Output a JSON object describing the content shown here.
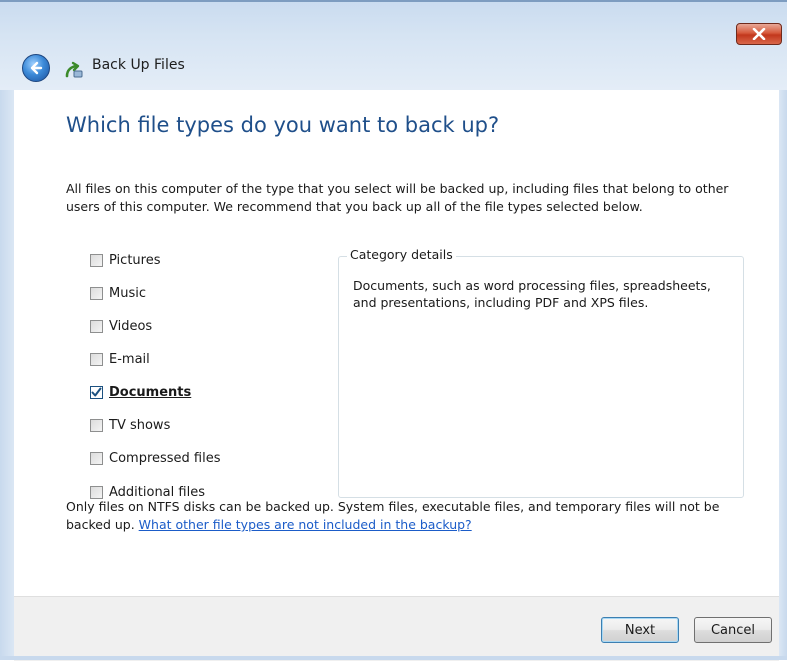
{
  "window": {
    "title": "Back Up Files"
  },
  "page": {
    "heading": "Which file types do you want to back up?",
    "intro": "All files on this computer of the type that you select will be backed up, including files that belong to other users of this computer. We recommend that you back up all of the file types selected below."
  },
  "file_types": [
    {
      "label": "Pictures",
      "checked": false
    },
    {
      "label": "Music",
      "checked": false
    },
    {
      "label": "Videos",
      "checked": false
    },
    {
      "label": "E-mail",
      "checked": false
    },
    {
      "label": "Documents",
      "checked": true
    },
    {
      "label": "TV shows",
      "checked": false
    },
    {
      "label": "Compressed files",
      "checked": false
    },
    {
      "label": "Additional files",
      "checked": false
    }
  ],
  "category_details": {
    "legend": "Category details",
    "text": "Documents, such as word processing files, spreadsheets, and presentations, including PDF and XPS files."
  },
  "note": {
    "text": "Only files on NTFS disks can be backed up. System files, executable files, and temporary files will not be backed up. ",
    "link": "What other file types are not included in the backup?"
  },
  "buttons": {
    "next": "Next",
    "cancel": "Cancel"
  },
  "colors": {
    "heading": "#1f4f8a",
    "link": "#1b5cc8",
    "close_button": "#c2371c",
    "check_mark": "#1c5180"
  },
  "icons": {
    "back": "back-arrow-icon",
    "app": "backup-icon",
    "close": "close-icon"
  }
}
